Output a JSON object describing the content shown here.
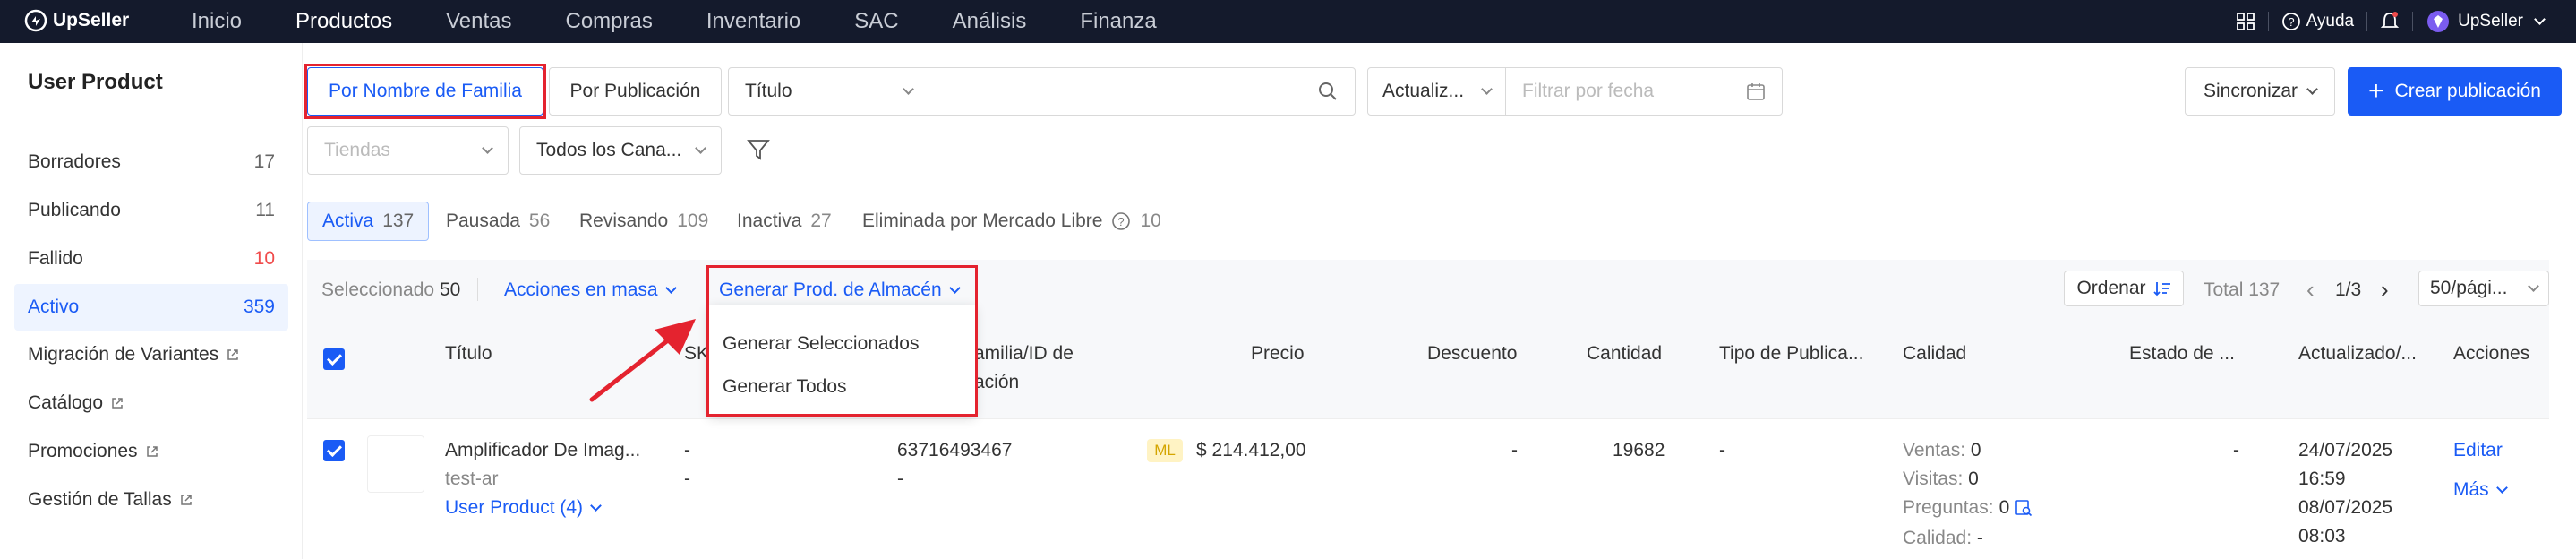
{
  "app": {
    "name": "UpSeller"
  },
  "nav": [
    "Inicio",
    "Productos",
    "Ventas",
    "Compras",
    "Inventario",
    "SAC",
    "Análisis",
    "Finanza"
  ],
  "topright": {
    "help": "Ayuda",
    "user": "UpSeller"
  },
  "sidebar": {
    "title": "User Product",
    "items": [
      {
        "label": "Borradores",
        "count": "17"
      },
      {
        "label": "Publicando",
        "count": "11"
      },
      {
        "label": "Fallido",
        "count": "10"
      },
      {
        "label": "Activo",
        "count": "359"
      }
    ],
    "links": [
      "Migración de Variantes",
      "Catálogo",
      "Promociones",
      "Gestión de Tallas"
    ]
  },
  "filters": {
    "by_family": "Por Nombre de Familia",
    "by_pub": "Por Publicación",
    "title_select": "Título",
    "date_select": "Actualiz...",
    "date_placeholder": "Filtrar por fecha",
    "stores_placeholder": "Tiendas",
    "channels": "Todos los Cana...",
    "sync": "Sincronizar",
    "create": "Crear publicación"
  },
  "tabs": [
    {
      "label": "Activa",
      "count": "137"
    },
    {
      "label": "Pausada",
      "count": "56"
    },
    {
      "label": "Revisando",
      "count": "109"
    },
    {
      "label": "Inactiva",
      "count": "27"
    },
    {
      "label": "Eliminada por Mercado Libre",
      "count": "10"
    }
  ],
  "toolbar": {
    "selected_label": "Seleccionado",
    "selected_count": "50",
    "bulk": "Acciones en masa",
    "generate": "Generar Prod. de Almacén",
    "sort": "Ordenar",
    "total": "Total 137",
    "page": "1/3",
    "per_page": "50/pági..."
  },
  "dropdown": [
    "Generar Seleccionados",
    "Generar Todos"
  ],
  "columns": {
    "title": "Título",
    "sku": "SK",
    "family_1": "amilia/ID de",
    "family_2": "ación",
    "price": "Precio",
    "discount": "Descuento",
    "qty": "Cantidad",
    "pubtype": "Tipo de Publica...",
    "quality": "Calidad",
    "state": "Estado de ...",
    "updated": "Actualizado/...",
    "actions": "Acciones"
  },
  "row": {
    "title": "Amplificador De Imag...",
    "sub": "test-ar",
    "user_product": "User Product (4)",
    "sku1": "-",
    "sku2": "-",
    "id": "63716493467",
    "id2": "-",
    "ml": "ML",
    "price": "$ 214.412,00",
    "discount": "-",
    "qty": "19682",
    "pubtype": "-",
    "sales": "Ventas:",
    "sales_v": "0",
    "visits": "Visitas:",
    "visits_v": "0",
    "questions": "Preguntas:",
    "questions_v": "0",
    "quality": "Calidad:",
    "quality_v": "-",
    "state": "-",
    "date1": "24/07/2025",
    "time1": "16:59",
    "date2": "08/07/2025",
    "time2": "08:03",
    "edit": "Editar",
    "more": "Más"
  },
  "colors": {
    "accent": "#1a5bf5",
    "highlight": "#e4232f",
    "topbar": "#141a2c"
  }
}
